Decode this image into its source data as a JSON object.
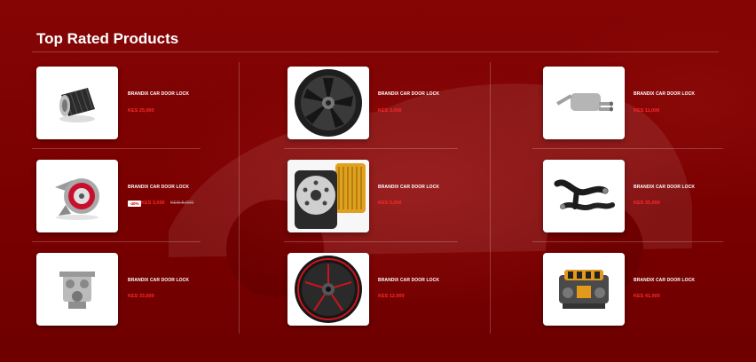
{
  "section": {
    "title": "Top Rated Products"
  },
  "products": [
    {
      "name": "BRANDIX CAR DOOR LOCK",
      "price": "KES 25,000",
      "image": "air-filter-icon"
    },
    {
      "name": "BRANDIX CAR DOOR LOCK",
      "price": "KES 3,000",
      "old_price": "KES 5,000",
      "discount": "-40%",
      "image": "turbocharger-icon"
    },
    {
      "name": "BRANDIX CAR DOOR LOCK",
      "price": "KES 33,000",
      "image": "engine-block-icon"
    },
    {
      "name": "BRANDIX CAR DOOR LOCK",
      "price": "KES 3,000",
      "image": "alloy-wheel-icon"
    },
    {
      "name": "BRANDIX CAR DOOR LOCK",
      "price": "KES 5,000",
      "image": "oil-filter-icon"
    },
    {
      "name": "BRANDIX CAR DOOR LOCK",
      "price": "KES 12,000",
      "image": "red-rim-wheel-icon"
    },
    {
      "name": "BRANDIX CAR DOOR LOCK",
      "price": "KES 11,000",
      "image": "exhaust-muffler-icon"
    },
    {
      "name": "BRANDIX CAR DOOR LOCK",
      "price": "KES 35,000",
      "image": "intercooler-hose-icon"
    },
    {
      "name": "BRANDIX CAR DOOR LOCK",
      "price": "KES 41,000",
      "image": "engine-icon"
    }
  ],
  "colors": {
    "background": "#7e0000",
    "price": "#ff2a2a",
    "text": "#ffffff"
  }
}
